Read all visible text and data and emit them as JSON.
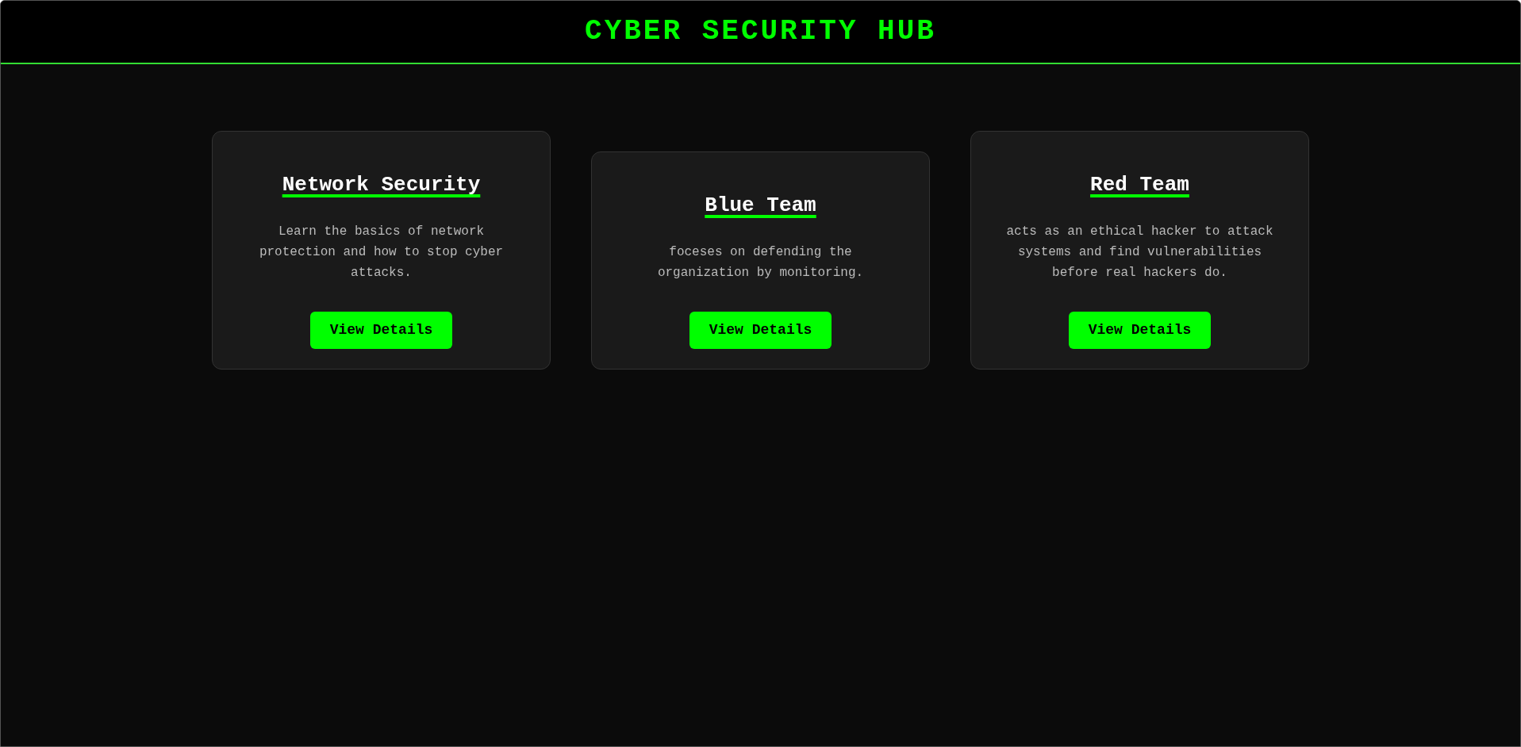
{
  "header": {
    "title": "CYBER SECURITY HUB"
  },
  "cards": [
    {
      "title": "Network Security",
      "description": "Learn the basics of network protection and how to stop cyber attacks.",
      "button": "View Details"
    },
    {
      "title": "Blue Team",
      "description": "foceses on defending the organization by monitoring.",
      "button": "View Details"
    },
    {
      "title": "Red Team",
      "description": "acts as an ethical hacker to attack systems and find vulnerabilities before real hackers do.",
      "button": "View Details"
    }
  ]
}
